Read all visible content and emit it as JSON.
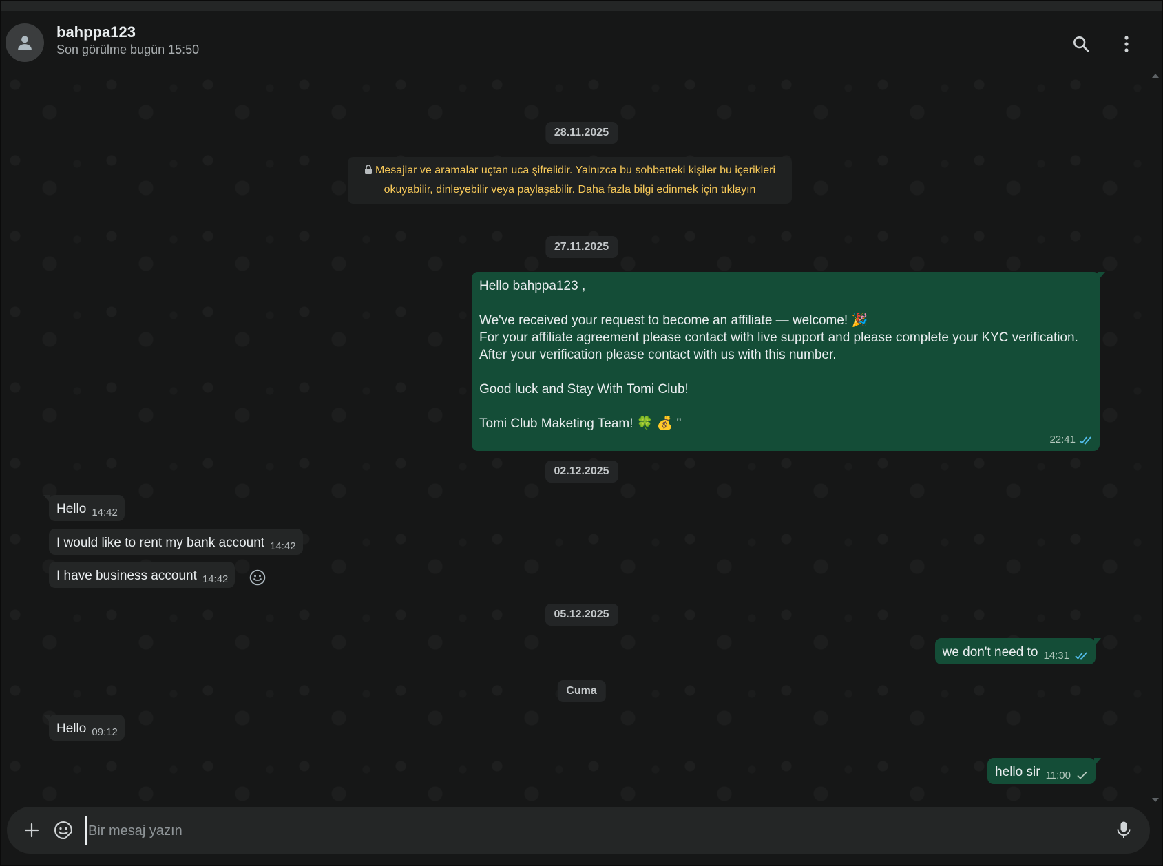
{
  "header": {
    "contact_name": "bahppa123",
    "status": "Son görülme bugün 15:50",
    "icons": [
      "avatar-icon",
      "search-icon",
      "menu-icon"
    ]
  },
  "dates": {
    "d1": "28.11.2025",
    "d2": "27.11.2025",
    "d3": "02.12.2025",
    "d4": "05.12.2025",
    "d5": "Cuma"
  },
  "encryption_notice": "Mesajlar ve aramalar uçtan uca şifrelidir. Yalnızca bu sohbetteki kişiler bu içerikleri okuyabilir, dinleyebilir veya paylaşabilir. Daha fazla bilgi edinmek için tıklayın",
  "messages": {
    "affiliate": {
      "line1": "Hello bahppa123 ,",
      "line2": "We've received your request to become an affiliate — welcome! 🎉",
      "line3": "For your affiliate agreement please contact with live support and please complete your KYC verification.",
      "line4": "After your verification please contact with us with this number.",
      "line5": "Good luck and Stay With Tomi Club!",
      "line6": "Tomi Club Maketing Team! 🍀 💰 \"",
      "time": "22:41",
      "status": "read"
    },
    "m1": {
      "text": "Hello",
      "time": "14:42"
    },
    "m2": {
      "text": "I would like to rent my bank account",
      "time": "14:42"
    },
    "m3": {
      "text": "I have business account",
      "time": "14:42"
    },
    "m4": {
      "text": "we don't need to",
      "time": "14:31",
      "status": "read"
    },
    "m5": {
      "text": "Hello",
      "time": "09:12"
    },
    "m6": {
      "text": "hello sir",
      "time": "11:00",
      "status": "sent"
    }
  },
  "composer": {
    "placeholder": "Bir mesaj yazın"
  },
  "colors": {
    "outgoing_bubble": "#144d37",
    "incoming_bubble": "#242626",
    "read_tick": "#53bdeb",
    "notice_text": "#f6c859"
  }
}
